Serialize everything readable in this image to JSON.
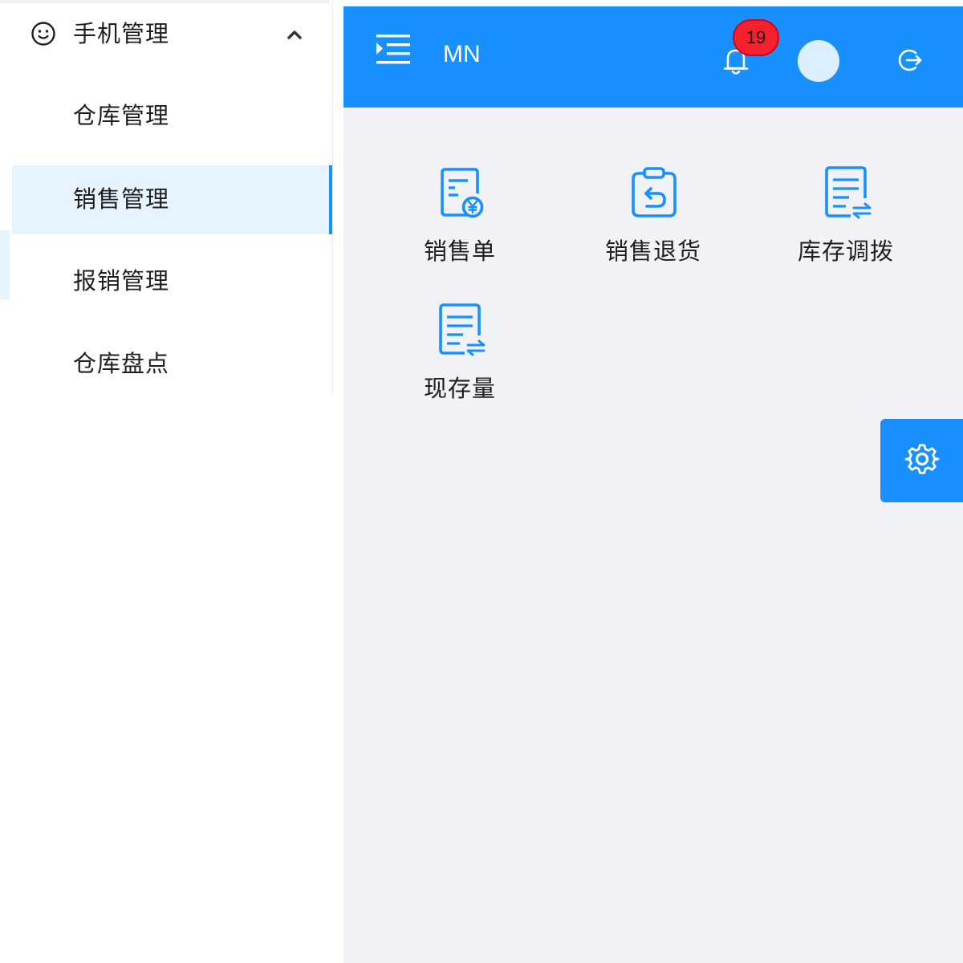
{
  "sidebar": {
    "group": {
      "label": "手机管理",
      "icon": "smile-icon",
      "expanded": true,
      "toggle_icon": "chevron-up-icon"
    },
    "items": [
      {
        "label": "仓库管理",
        "active": false
      },
      {
        "label": "销售管理",
        "active": true
      },
      {
        "label": "报销管理",
        "active": false
      },
      {
        "label": "仓库盘点",
        "active": false
      }
    ]
  },
  "header": {
    "menu_icon": "menu-indent-icon",
    "brand": "MN",
    "notification_icon": "bell-icon",
    "notification_count": "19",
    "avatar": "avatar",
    "logout_icon": "logout-icon"
  },
  "main": {
    "tiles": [
      {
        "label": "销售单",
        "icon": "sales-order-icon"
      },
      {
        "label": "销售退货",
        "icon": "sales-return-icon"
      },
      {
        "label": "库存调拨",
        "icon": "stock-transfer-icon"
      },
      {
        "label": "现存量",
        "icon": "stock-quantity-icon"
      }
    ],
    "settings_icon": "gear-icon"
  },
  "colors": {
    "primary": "#1890ff",
    "active_bg": "#e6f4ff",
    "content_bg": "#f0f2f5",
    "badge": "#f5222d"
  }
}
